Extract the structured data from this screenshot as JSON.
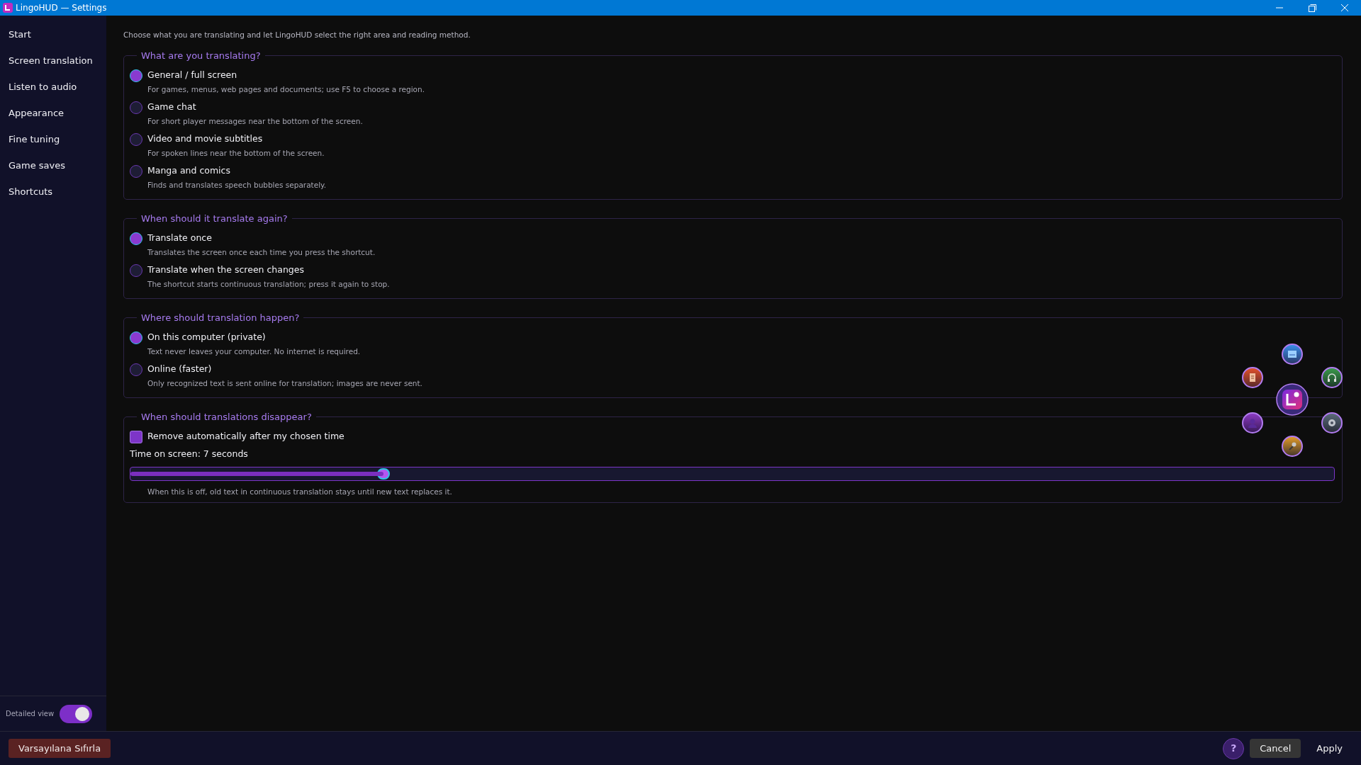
{
  "window": {
    "title": "LingoHUD — Settings"
  },
  "sidebar": {
    "items": [
      {
        "label": "Start"
      },
      {
        "label": "Screen translation"
      },
      {
        "label": "Listen to audio"
      },
      {
        "label": "Appearance"
      },
      {
        "label": "Fine tuning"
      },
      {
        "label": "Game saves"
      },
      {
        "label": "Shortcuts"
      }
    ],
    "detailed_view": {
      "label": "Detailed view",
      "on": true
    }
  },
  "intro": "Choose what you are translating and let LingoHUD select the right area and reading method.",
  "groups": [
    {
      "title": "What are you translating?",
      "kind": "radio",
      "options": [
        {
          "label": "General / full screen",
          "description": "For games, menus, web pages and documents; use F5 to choose a region.",
          "selected": true
        },
        {
          "label": "Game chat",
          "description": "For short player messages near the bottom of the screen.",
          "selected": false
        },
        {
          "label": "Video and movie subtitles",
          "description": "For spoken lines near the bottom of the screen.",
          "selected": false
        },
        {
          "label": "Manga and comics",
          "description": "Finds and translates speech bubbles separately.",
          "selected": false
        }
      ]
    },
    {
      "title": "When should it translate again?",
      "kind": "radio",
      "options": [
        {
          "label": "Translate once",
          "description": "Translates the screen once each time you press the shortcut.",
          "selected": true
        },
        {
          "label": "Translate when the screen changes",
          "description": "The shortcut starts continuous translation; press it again to stop.",
          "selected": false
        }
      ]
    },
    {
      "title": "Where should translation happen?",
      "kind": "radio",
      "options": [
        {
          "label": "On this computer (private)",
          "description": "Text never leaves your computer. No internet is required.",
          "selected": true
        },
        {
          "label": "Online (faster)",
          "description": "Only recognized text is sent online for translation; images are never sent.",
          "selected": false
        }
      ]
    },
    {
      "title": "When should translations disappear?",
      "kind": "timer",
      "checkbox": {
        "label": "Remove automatically after my chosen time",
        "checked": true
      },
      "time_label": "Time on screen: 7 seconds",
      "slider": {
        "level": 0.21
      },
      "note": "When this is off, old text in continuous translation stays until new text replaces it."
    }
  ],
  "footer": {
    "reset": "Varsayılana Sıfırla",
    "help": "?",
    "cancel": "Cancel",
    "apply": "Apply"
  }
}
